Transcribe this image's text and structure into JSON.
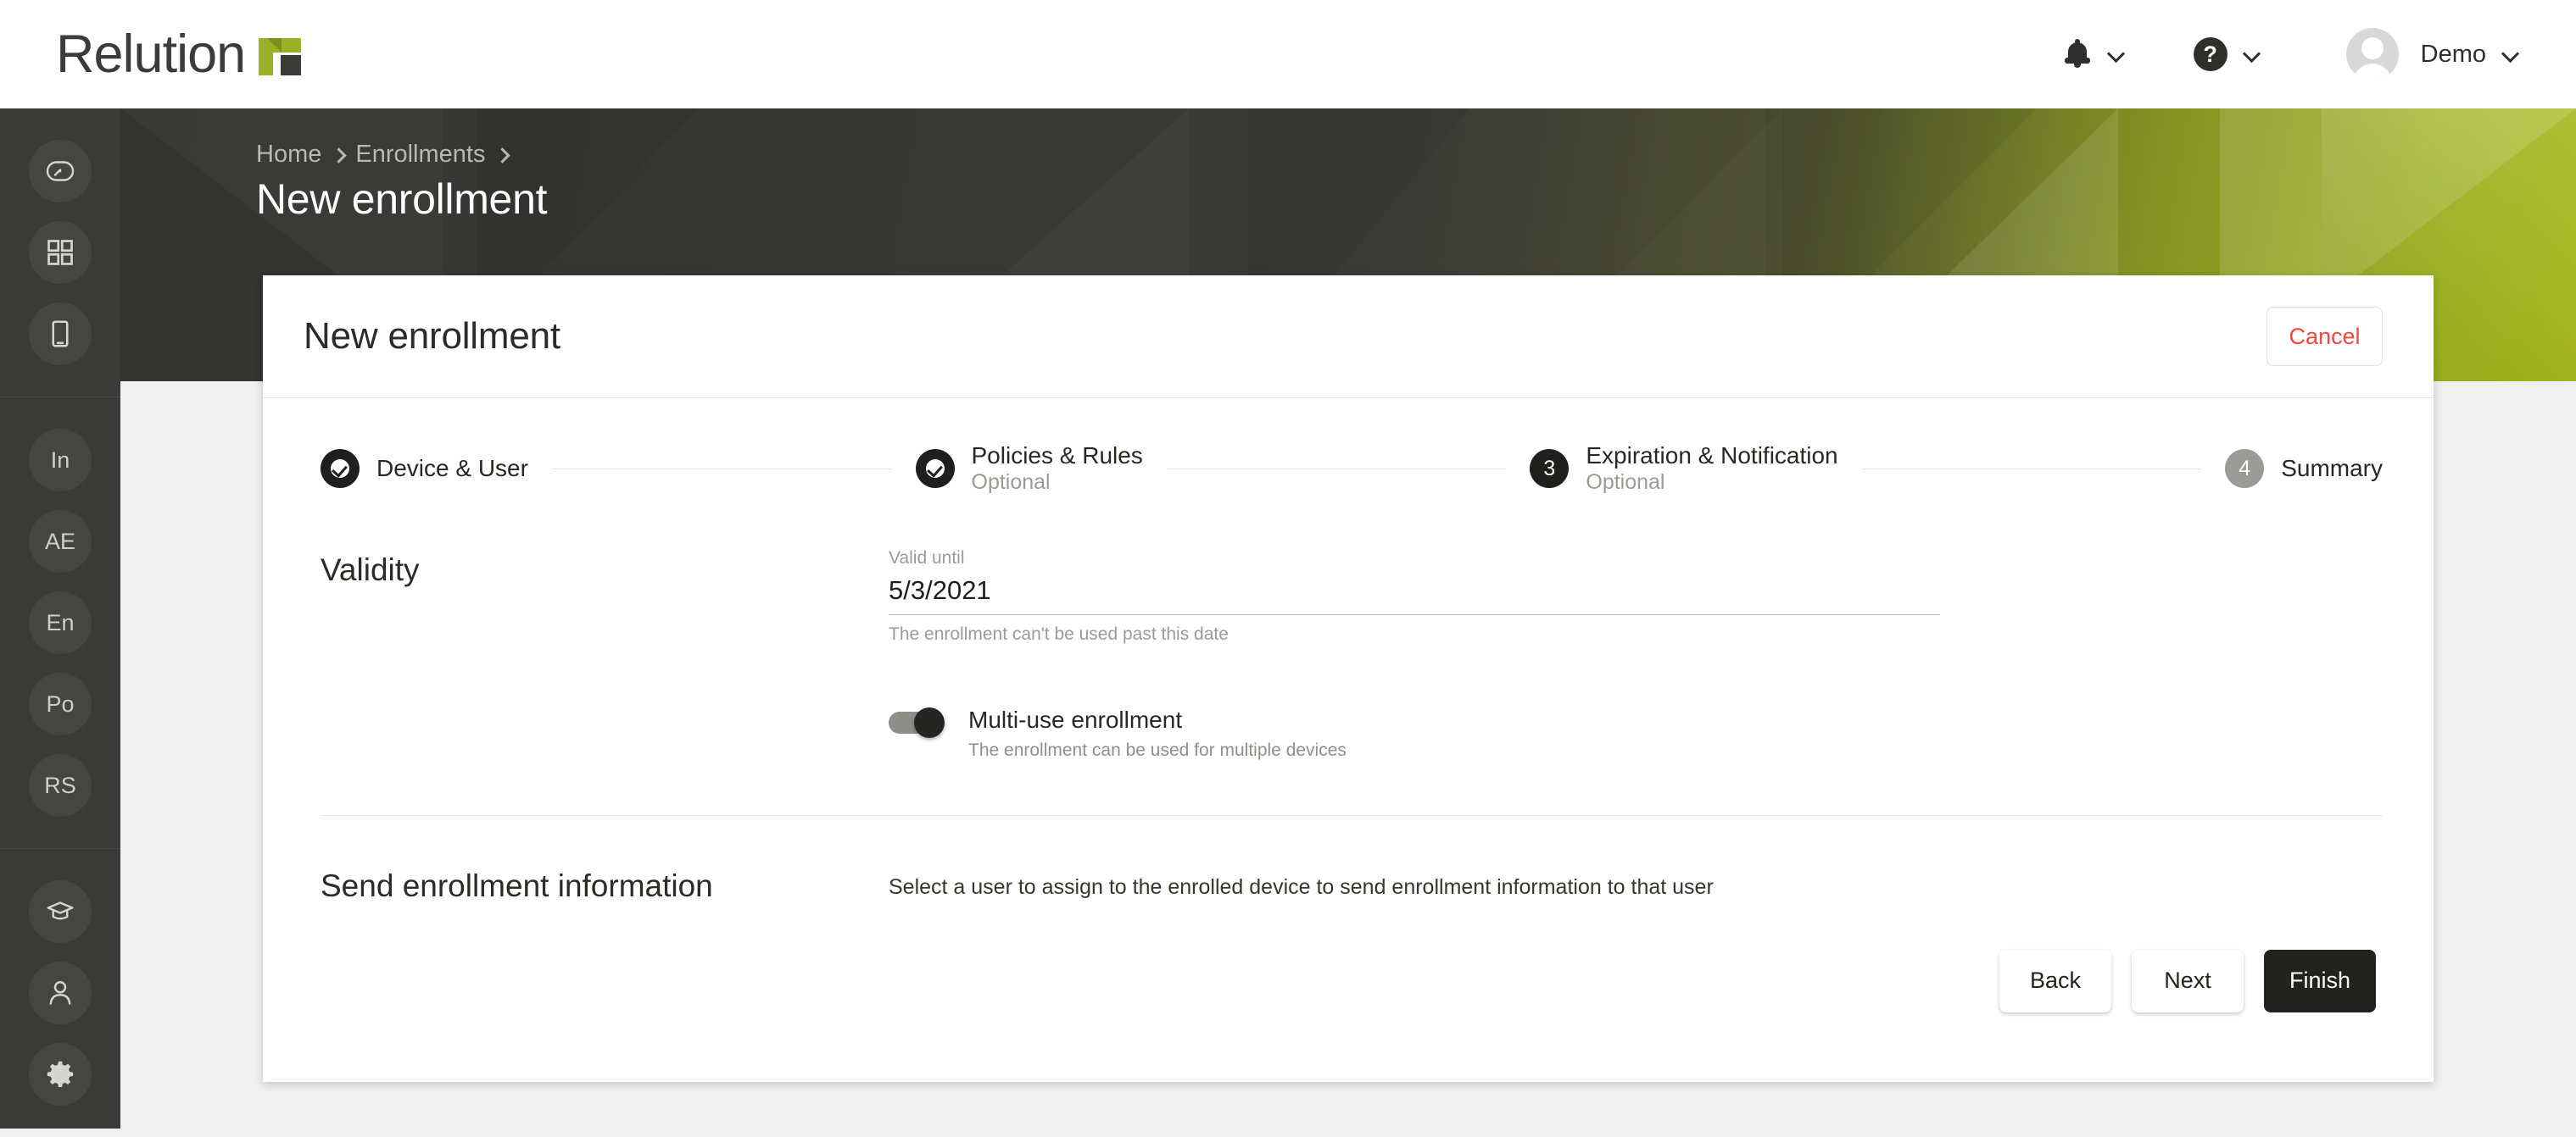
{
  "app": {
    "brand_name": "Relution"
  },
  "topbar": {
    "notifications_icon": "bell-icon",
    "help_icon": "help-circle-icon",
    "chevron_icon": "chevron-down-icon",
    "avatar_icon": "avatar-placeholder-icon",
    "user_name": "Demo"
  },
  "sidebar": {
    "groups": [
      {
        "items": [
          {
            "name": "dashboard",
            "icon": "gauge-icon",
            "type": "icon"
          },
          {
            "name": "apps",
            "icon": "grid-icon",
            "type": "icon"
          },
          {
            "name": "devices",
            "icon": "tablet-icon",
            "type": "icon"
          }
        ]
      },
      {
        "items": [
          {
            "name": "inventory",
            "label": "In",
            "type": "text"
          },
          {
            "name": "android-enterprise",
            "label": "AE",
            "type": "text"
          },
          {
            "name": "enrollments",
            "label": "En",
            "type": "text"
          },
          {
            "name": "policies",
            "label": "Po",
            "type": "text"
          },
          {
            "name": "rule-sets",
            "label": "RS",
            "type": "text"
          }
        ]
      },
      {
        "items": [
          {
            "name": "education",
            "icon": "graduation-cap-icon",
            "type": "icon"
          },
          {
            "name": "users",
            "icon": "user-icon",
            "type": "icon"
          },
          {
            "name": "settings",
            "icon": "gear-icon",
            "type": "icon"
          }
        ]
      }
    ]
  },
  "breadcrumb": {
    "items": [
      "Home",
      "Enrollments"
    ],
    "separator": "chevron-right-icon"
  },
  "page": {
    "title": "New enrollment"
  },
  "card": {
    "title": "New enrollment",
    "cancel_label": "Cancel"
  },
  "stepper": {
    "steps": [
      {
        "index": "1",
        "label": "Device & User",
        "sub": "",
        "state": "done"
      },
      {
        "index": "2",
        "label": "Policies & Rules",
        "sub": "Optional",
        "state": "done"
      },
      {
        "index": "3",
        "label": "Expiration & Notification",
        "sub": "Optional",
        "state": "active"
      },
      {
        "index": "4",
        "label": "Summary",
        "sub": "",
        "state": "todo"
      }
    ]
  },
  "validity": {
    "section_title": "Validity",
    "valid_until_label": "Valid until",
    "valid_until_value": "5/3/2021",
    "valid_until_hint": "The enrollment can't be used past this date",
    "multi_use_label": "Multi-use enrollment",
    "multi_use_hint": "The enrollment can be used for multiple devices",
    "multi_use_state": "on"
  },
  "send_info": {
    "section_title": "Send enrollment information",
    "description": "Select a user to assign to the enrolled device to send enrollment information to that user"
  },
  "footer": {
    "back_label": "Back",
    "next_label": "Next",
    "finish_label": "Finish"
  },
  "colors": {
    "brand_green": "#9cb026",
    "accent_dark": "#222220",
    "danger_red": "#f4483f",
    "sidebar_bg": "#3a3a38",
    "page_bg": "#f0f0f0"
  }
}
